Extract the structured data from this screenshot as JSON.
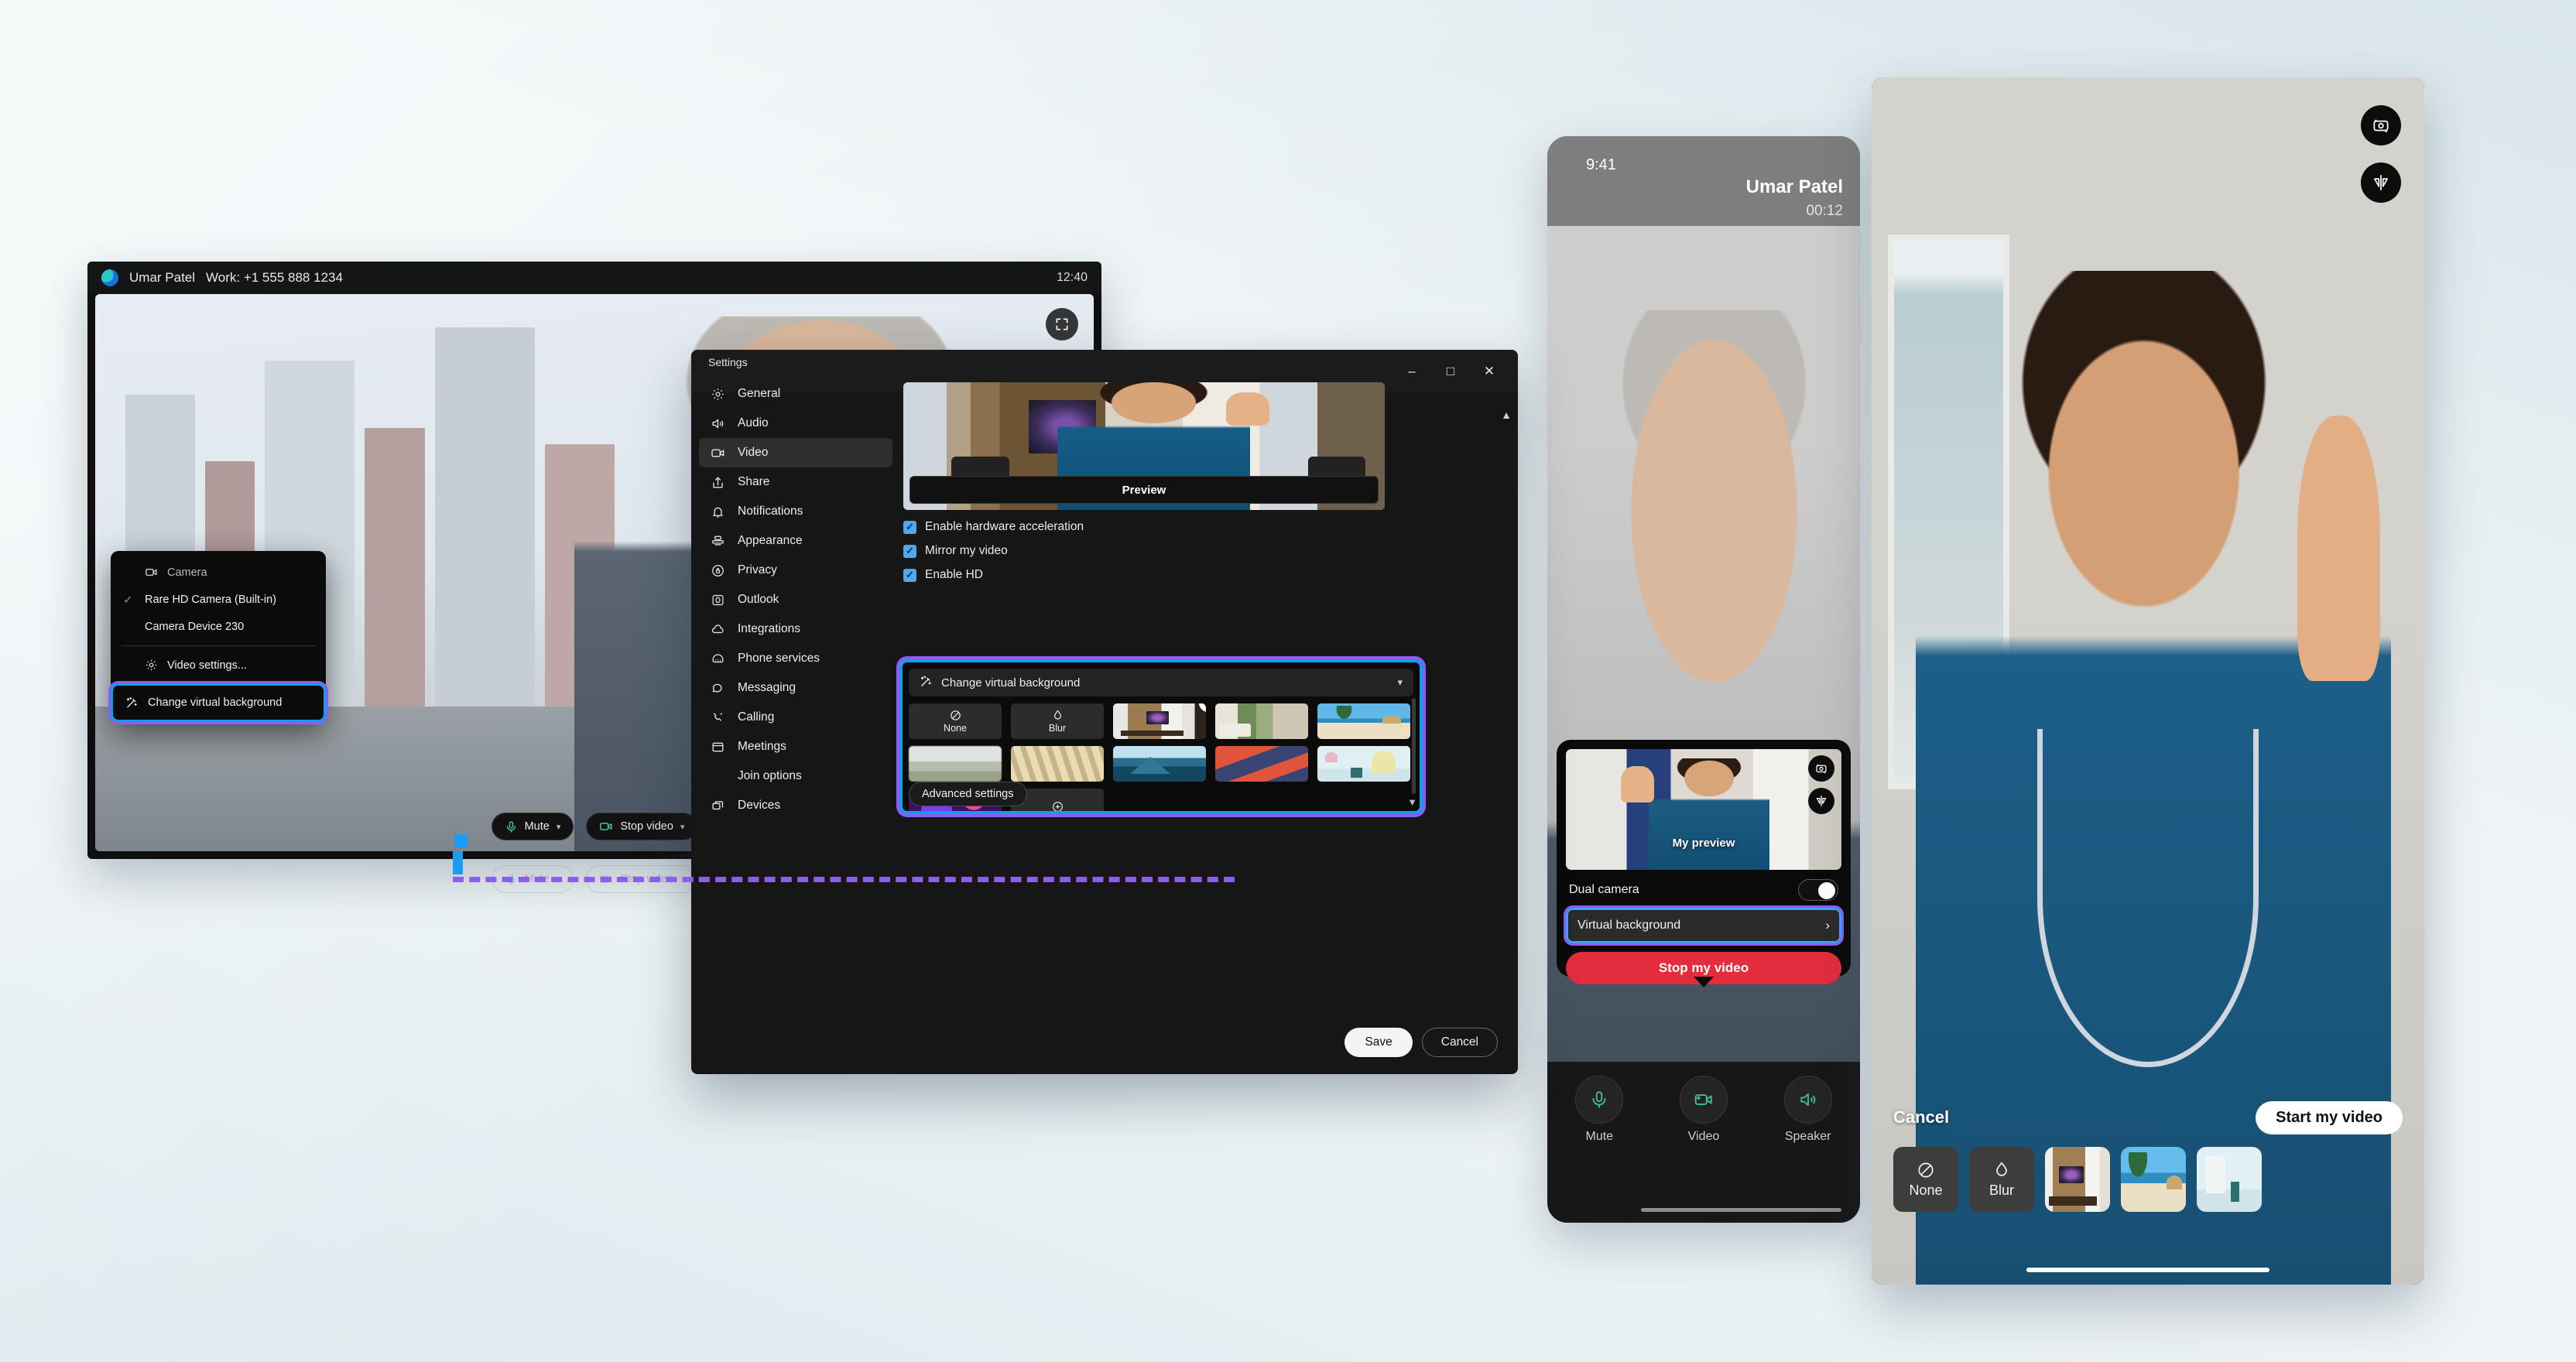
{
  "desktop": {
    "titlebar": {
      "user_name": "Umar Patel",
      "work_number": "Work: +1 555 888 1234",
      "clock": "12:40"
    },
    "expand_icon": "fullscreen-icon",
    "controls": [
      {
        "label": "Mute",
        "icon": "microphone-icon"
      },
      {
        "label": "Stop video",
        "icon": "video-camera-icon"
      }
    ],
    "camera_menu": {
      "header": "Camera",
      "devices": [
        {
          "label": "Rare HD Camera (Built-in)",
          "checked": true
        },
        {
          "label": "Camera Device 230",
          "checked": false
        }
      ],
      "video_settings": "Video settings...",
      "change_virtual_background": "Change virtual background"
    }
  },
  "settings": {
    "window_title": "Settings",
    "window_controls": {
      "minimize": "–",
      "maximize": "□",
      "close": "✕"
    },
    "nav": [
      {
        "label": "General",
        "icon": "gear-icon",
        "active": false
      },
      {
        "label": "Audio",
        "icon": "speaker-icon",
        "active": false
      },
      {
        "label": "Video",
        "icon": "video-camera-icon",
        "active": true
      },
      {
        "label": "Share",
        "icon": "share-icon",
        "active": false
      },
      {
        "label": "Notifications",
        "icon": "bell-icon",
        "active": false
      },
      {
        "label": "Appearance",
        "icon": "appearance-icon",
        "active": false
      },
      {
        "label": "Privacy",
        "icon": "lock-icon",
        "active": false
      },
      {
        "label": "Outlook",
        "icon": "outlook-icon",
        "active": false
      },
      {
        "label": "Integrations",
        "icon": "cloud-icon",
        "active": false
      },
      {
        "label": "Phone services",
        "icon": "phone-icon",
        "active": false
      },
      {
        "label": "Messaging",
        "icon": "chat-bubble-icon",
        "active": false
      },
      {
        "label": "Calling",
        "icon": "call-icon",
        "active": false
      },
      {
        "label": "Meetings",
        "icon": "calendar-icon",
        "active": false
      },
      {
        "label": "Join options",
        "icon": "",
        "active": false
      },
      {
        "label": "Devices",
        "icon": "devices-icon",
        "active": false
      }
    ],
    "preview_label": "Preview",
    "checkboxes": [
      {
        "label": "Enable hardware acceleration",
        "checked": true
      },
      {
        "label": "Mirror my video",
        "checked": true
      },
      {
        "label": "Enable HD",
        "checked": true
      }
    ],
    "virtual_background": {
      "header": "Change virtual background",
      "header_icon": "magic-wand-icon",
      "thumbnails": [
        {
          "name": "None",
          "type": "none",
          "selected": true
        },
        {
          "name": "Blur",
          "type": "blur",
          "selected": false
        },
        {
          "name": "Office",
          "type": "image",
          "selected": false,
          "removable": true
        },
        {
          "name": "Forest living room",
          "type": "image",
          "selected": false
        },
        {
          "name": "Beach palm",
          "type": "image",
          "selected": false
        },
        {
          "name": "Mountain haze",
          "type": "image",
          "selected": false
        },
        {
          "name": "Window blinds",
          "type": "image",
          "selected": false
        },
        {
          "name": "Blue mountains",
          "type": "image",
          "selected": false
        },
        {
          "name": "Red zigzag",
          "type": "image",
          "selected": false
        },
        {
          "name": "Pastel room",
          "type": "image",
          "selected": false
        },
        {
          "name": "Neon bokeh",
          "type": "image",
          "selected": false
        },
        {
          "name": "Add background",
          "type": "add",
          "selected": false
        }
      ],
      "advanced_settings": "Advanced settings",
      "remove_label": "✕"
    },
    "footer": {
      "save": "Save",
      "cancel": "Cancel"
    }
  },
  "phone_mid": {
    "status_time": "9:41",
    "caller_name": "Umar Patel",
    "call_duration": "00:12",
    "preview_label": "My preview",
    "preview_buttons": [
      {
        "icon": "switch-camera-icon"
      },
      {
        "icon": "mirror-flip-icon"
      }
    ],
    "dual_camera_label": "Dual camera",
    "dual_camera_on": false,
    "virtual_background_label": "Virtual background",
    "virtual_background_arrow": "›",
    "stop_video_label": "Stop my video",
    "bottom_bar": [
      {
        "label": "Mute",
        "icon": "microphone-icon"
      },
      {
        "label": "Video",
        "icon": "video-camera-icon"
      },
      {
        "label": "Speaker",
        "icon": "speaker-icon"
      }
    ]
  },
  "phone_right": {
    "top_buttons": [
      {
        "icon": "switch-camera-icon"
      },
      {
        "icon": "mirror-flip-icon"
      }
    ],
    "cancel_label": "Cancel",
    "start_video_label": "Start my video",
    "thumbnails": [
      {
        "name": "None",
        "type": "none",
        "selected": true
      },
      {
        "name": "Blur",
        "type": "blur",
        "selected": false
      },
      {
        "name": "Office",
        "type": "image",
        "selected": false
      },
      {
        "name": "Beach palm",
        "type": "image",
        "selected": false
      },
      {
        "name": "Pastel room",
        "type": "image",
        "selected": false
      }
    ]
  },
  "colors": {
    "highlight_blue": "#0f9fe8",
    "annotation_purple": "#8b5cf6",
    "accent_blue": "#3ba4f0",
    "danger_red": "#e32c3d"
  }
}
